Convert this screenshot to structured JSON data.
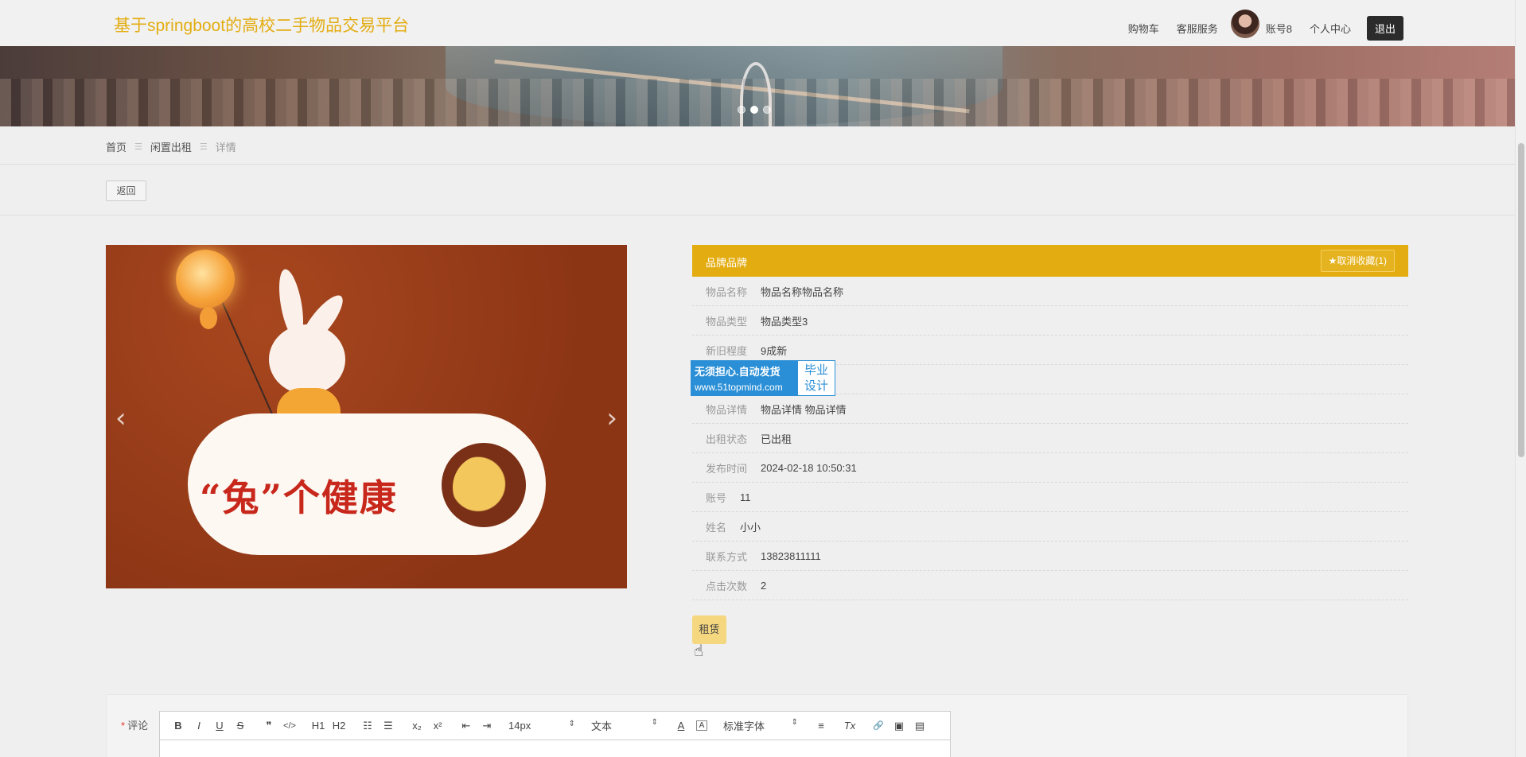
{
  "header": {
    "site_title": "基于springboot的高校二手物品交易平台",
    "nav": [
      "购物车",
      "客服服务",
      "账号8",
      "个人中心"
    ],
    "logout_label": "退出"
  },
  "breadcrumb": {
    "home": "首页",
    "section": "闲置出租",
    "current": "详情",
    "separator": "☰"
  },
  "back_label": "返回",
  "carousel": {
    "image_text": "“兔”个健康",
    "prev_icon": "‹",
    "next_icon": "›",
    "active_dot": 1
  },
  "detail": {
    "header_title": "品牌品牌",
    "favorite_label": "★取消收藏(1)",
    "fields": [
      {
        "label": "物品名称",
        "value": "物品名称物品名称"
      },
      {
        "label": "物品类型",
        "value": "物品类型3"
      },
      {
        "label": "新旧程度",
        "value": "9成新"
      },
      {
        "label": "",
        "value": ""
      },
      {
        "label": "物品详情",
        "value": "物品详情 物品详情"
      },
      {
        "label": "出租状态",
        "value": "已出租"
      },
      {
        "label": "发布时间",
        "value": "2024-02-18 10:50:31"
      },
      {
        "label": "账号",
        "value": "11"
      },
      {
        "label": "姓名",
        "value": "小小"
      },
      {
        "label": "联系方式",
        "value": "13823811111"
      },
      {
        "label": "点击次数",
        "value": "2"
      }
    ],
    "rent_label": "租赁"
  },
  "watermark": {
    "line1": "无须担心.自动发货",
    "line2": "www.51topmind.com",
    "badge1": "毕业",
    "badge2": "设计"
  },
  "comment": {
    "required_mark": "*",
    "label": "评论",
    "toolbar": {
      "bold": "B",
      "italic": "I",
      "underline": "U",
      "strike": "S",
      "quote": "❞",
      "code": "</>",
      "h1": "H1",
      "h2": "H2",
      "ordered_list": "☷",
      "bullet_list": "☰",
      "subscript": "x₂",
      "superscript": "x²",
      "outdent": "⇤",
      "indent": "⇥",
      "font_size": "14px",
      "text_type": "文本",
      "font_family": "标准字体",
      "font_color": "A",
      "background_color": "A",
      "align": "≡",
      "clear_format": "Tx",
      "link": "🔗",
      "image": "▣",
      "video": "▤"
    }
  },
  "colors": {
    "brand": "#e3ad12",
    "rent_button": "#f5d77f",
    "watermark_blue": "#2a8fd6"
  }
}
